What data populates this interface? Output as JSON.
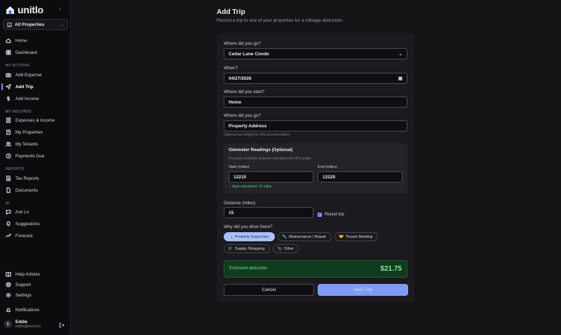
{
  "app": {
    "name": "unitlo"
  },
  "property_selector": {
    "value": "All Properties"
  },
  "nav": {
    "top": [
      {
        "label": "Home",
        "icon": "home-icon"
      },
      {
        "label": "Dashboard",
        "icon": "grid-icon"
      }
    ],
    "sections": [
      {
        "title": "MY ACTIONS",
        "items": [
          {
            "label": "Add Expense",
            "icon": "camera-icon"
          },
          {
            "label": "Add Trip",
            "icon": "send-icon",
            "active": true
          },
          {
            "label": "Add Income",
            "icon": "dollar-icon"
          }
        ]
      },
      {
        "title": "MY RECORDS",
        "items": [
          {
            "label": "Expenses & Income",
            "icon": "receipt-icon"
          },
          {
            "label": "My Properties",
            "icon": "building-icon"
          },
          {
            "label": "My Tenants",
            "icon": "users-icon"
          },
          {
            "label": "Payments Due",
            "icon": "clock-icon"
          }
        ]
      },
      {
        "title": "REPORTS",
        "items": [
          {
            "label": "Tax Reports",
            "icon": "report-icon"
          },
          {
            "label": "Documents",
            "icon": "document-icon"
          }
        ]
      },
      {
        "title": "AI",
        "items": [
          {
            "label": "Ask Lo",
            "icon": "chat-icon"
          },
          {
            "label": "Suggestions",
            "icon": "bulb-icon"
          },
          {
            "label": "Forecast",
            "icon": "trend-icon"
          }
        ]
      }
    ],
    "bottom": [
      {
        "label": "Help Articles",
        "icon": "book-icon"
      },
      {
        "label": "Support",
        "icon": "lifebuoy-icon"
      },
      {
        "label": "Settings",
        "icon": "gear-icon"
      },
      {
        "label": "Notifications",
        "icon": "bell-icon"
      }
    ]
  },
  "user": {
    "initial": "E",
    "name": "Eddie",
    "email": "eddie@test.com"
  },
  "page": {
    "title": "Add Trip",
    "subtitle": "Record a trip to one of your properties for a mileage deduction."
  },
  "form": {
    "property": {
      "label": "Where did you go?",
      "value": "Cedar Lane Condo"
    },
    "date": {
      "label": "When?",
      "value": "04/27/2026"
    },
    "start": {
      "label": "Where did you start?",
      "value": "Home"
    },
    "destination": {
      "label": "Where did you go?",
      "value": "Property Address",
      "hint": "Optional but helpful for IRS documentation"
    },
    "odometer": {
      "title": "Odometer Readings (Optional)",
      "description": "Provides verifiable distance calculation for IRS audits",
      "start_label": "Start (miles)",
      "start_value": "12210",
      "end_label": "End (miles)",
      "end_value": "12225",
      "auto_calc": "✓ Auto-calculated: 15 miles"
    },
    "distance": {
      "label": "Distance (miles)",
      "value": "15"
    },
    "round_trip": {
      "label": "Round trip",
      "checked": true
    },
    "purpose": {
      "label": "Why did you drive there?",
      "options": [
        {
          "emoji": "🔍",
          "label": "Property Inspection",
          "selected": true
        },
        {
          "emoji": "🔧",
          "label": "Maintenance / Repair"
        },
        {
          "emoji": "🤝",
          "label": "Tenant Meeting"
        },
        {
          "emoji": "🛒",
          "label": "Supply Shopping"
        },
        {
          "emoji": "📎",
          "label": "Other"
        }
      ]
    },
    "estimate": {
      "label": "Estimated deduction",
      "value": "$21.75"
    },
    "cancel_label": "Cancel",
    "save_label": "Save Trip"
  },
  "colors": {
    "accent": "#7b9bff",
    "success": "#4fd37a",
    "background": "#141417",
    "sidebar": "#0c0c0e"
  }
}
